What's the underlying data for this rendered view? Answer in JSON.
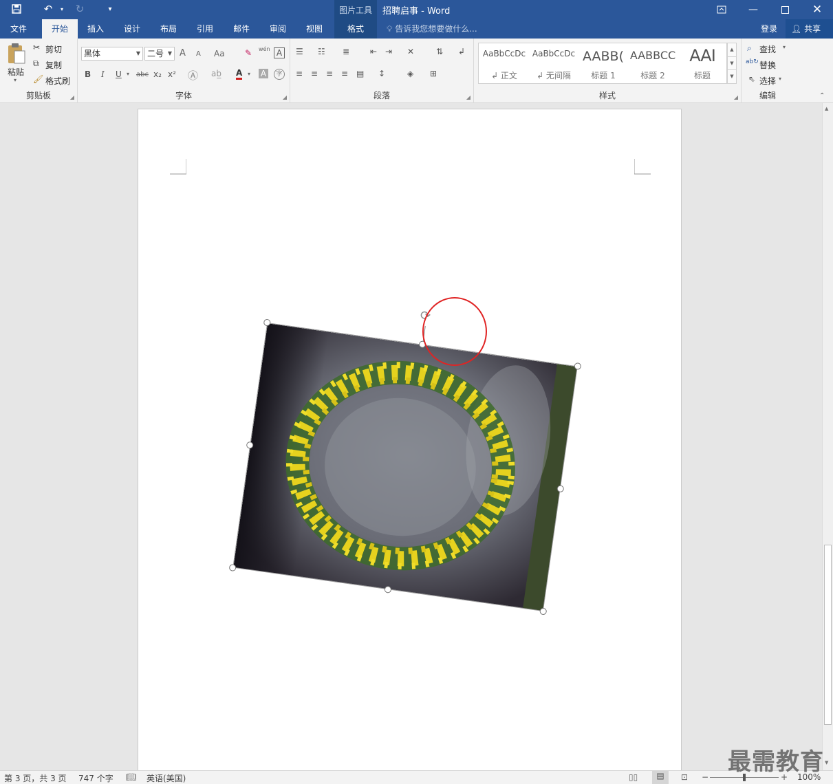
{
  "titlebar": {
    "context_tools": "图片工具",
    "title": "招聘启事 - Word",
    "icons": [
      "save-icon",
      "undo-icon",
      "redo-icon",
      "customize-qat-icon",
      "ribbon-display-options-icon",
      "minimize-icon",
      "maximize-icon",
      "close-icon"
    ]
  },
  "tabs": {
    "file": "文件",
    "home": "开始",
    "insert": "插入",
    "design": "设计",
    "layout": "布局",
    "references": "引用",
    "mailings": "邮件",
    "review": "审阅",
    "view": "视图",
    "format": "格式",
    "tell_me": "告诉我您想要做什么...",
    "signin": "登录",
    "share": "共享"
  },
  "clipboard": {
    "paste": "粘贴",
    "cut": "剪切",
    "copy": "复制",
    "format_painter": "格式刷",
    "group": "剪贴板"
  },
  "font": {
    "name": "黑体",
    "size": "二号",
    "group": "字体",
    "bold": "B",
    "italic": "I",
    "underline": "U",
    "strike": "abc",
    "subscript": "x₂",
    "superscript": "x²",
    "change_case": "Aa",
    "phonetic": "wén",
    "grow": "A",
    "shrink": "A",
    "font_color": "A",
    "char_border": "A",
    "char_shading": "A",
    "enclose": "字",
    "accent_color": "#d11f1f"
  },
  "paragraph": {
    "group": "段落"
  },
  "styles": {
    "group": "样式",
    "items": [
      {
        "preview": "AaBbCcDc",
        "name": "↲ 正文"
      },
      {
        "preview": "AaBbCcDc",
        "name": "↲ 无间隔"
      },
      {
        "preview": "AABB(",
        "name": "标题 1"
      },
      {
        "preview": "AABBCC",
        "name": "标题 2"
      },
      {
        "preview": "AAI",
        "name": "标题"
      }
    ]
  },
  "editing": {
    "find": "查找",
    "replace": "替换",
    "select": "选择",
    "group": "编辑"
  },
  "status": {
    "page": "第 3 页，共 3 页",
    "words": "747 个字",
    "language": "英语(美国)",
    "zoom": "100%",
    "zoom_minus": "−",
    "zoom_plus": "+"
  },
  "image": {
    "rotation_deg": 8
  },
  "watermark": "最需教育",
  "colors": {
    "brand": "#2b579a",
    "highlight": "#e02424"
  }
}
